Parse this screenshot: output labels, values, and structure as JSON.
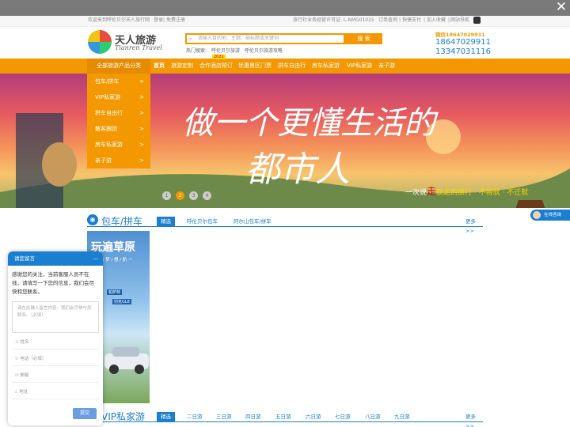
{
  "topbar": {
    "close_glyph": "✕"
  },
  "info": {
    "welcome": "欢迎来到呼伦贝尔天人旅行网",
    "login": "登录",
    "register": "免费注册",
    "license": "旅行社业务经营许可证: L-NMG01025",
    "order": "订单查询",
    "quickpay": "快捷支付",
    "fav": "加入收藏",
    "sitenav": "网站导航"
  },
  "logo": {
    "cn": "天人旅游",
    "en": "Tianren Travel"
  },
  "search": {
    "placeholder": "请输入目的地、主题、副标题或关键词",
    "button": "搜 索"
  },
  "hot": {
    "label": "热门搜索:",
    "items": [
      "呼伦贝尔旅游",
      "呼伦贝尔旅游攻略"
    ]
  },
  "contact": {
    "wechat": "微信18647029911",
    "tel1": "18647029911",
    "tel2": "13347031116"
  },
  "nav": {
    "category": "全部旅游产品分类",
    "items": [
      "首页",
      "旅游定制",
      "合作酒店预订",
      "优惠景区门票",
      "拼车自由行",
      "房车私家游",
      "VIP私家游",
      "亲子游"
    ],
    "badge": "2021"
  },
  "catmenu": [
    {
      "label": "包车/拼车",
      "arrow": ">"
    },
    {
      "label": "VIP私家游",
      "arrow": ">"
    },
    {
      "label": "拼车自由行",
      "arrow": ">"
    },
    {
      "label": "散客跟团",
      "arrow": ">"
    },
    {
      "label": "房车私家游",
      "arrow": ">"
    },
    {
      "label": "亲子游",
      "arrow": ">"
    }
  ],
  "banner": {
    "line1": "做一个更懂生活的",
    "line2": "都市人",
    "slogan_pre": "一次说",
    "slogan_hl": "走",
    "slogan_post": "就走的旅行 · 不将就 · 不迁就",
    "dots": [
      "1",
      "2",
      "3",
      "4"
    ],
    "active_dot": 2
  },
  "section1": {
    "title": "包车/拼车",
    "tabs": [
      "精选",
      "呼伦贝尔包车",
      "阿尔山包车/拼车"
    ],
    "more": "更多>>",
    "card": {
      "title": "玩遍草原",
      "sub": "一 方 / 梦 / 想 / 航 一",
      "tag1": "帕萨特",
      "tag2": "别克GL8"
    }
  },
  "section2": {
    "title": "VIP私家游",
    "tabs": [
      "精选",
      "二日游",
      "三日游",
      "四日游",
      "五日游",
      "六日游",
      "七日游",
      "八日游",
      "九日游"
    ],
    "more": "更多>>"
  },
  "chat": {
    "title": "请您留言",
    "minimize": "—",
    "message": "感谢您的关注，当前客服人员不在线，请填写一下您的信息，我们会尽快和您联系。",
    "textarea_placeholder": "请在此输入留言内容，我们会尽快与您联系。（必填）",
    "fields": [
      "姓名",
      "电话（必填）",
      "邮箱",
      "地址"
    ],
    "submit": "提交"
  },
  "online": {
    "label": "在线咨询"
  }
}
